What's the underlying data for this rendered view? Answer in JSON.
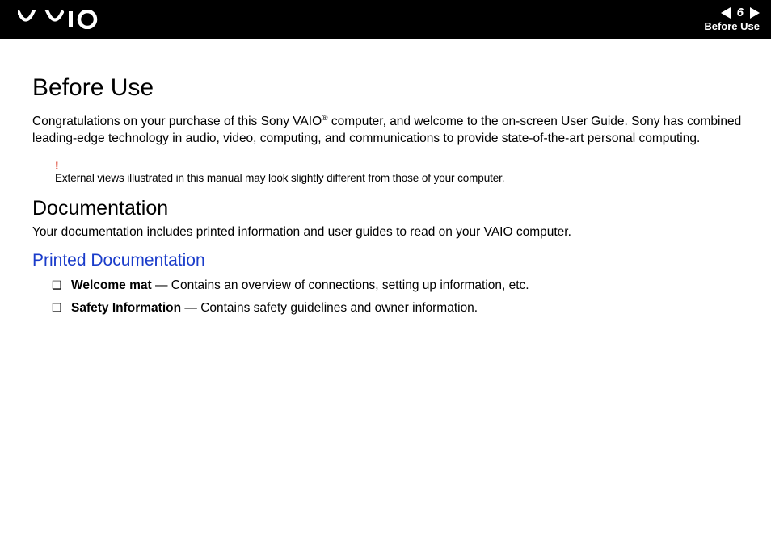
{
  "header": {
    "page_number": "6",
    "section": "Before Use"
  },
  "content": {
    "title": "Before Use",
    "intro_pre": "Congratulations on your purchase of this Sony VAIO",
    "intro_post": " computer, and welcome to the on-screen User Guide. Sony has combined leading-edge technology in audio, video, computing, and communications to provide state-of-the-art personal computing.",
    "note_bang": "!",
    "note_text": "External views illustrated in this manual may look slightly different from those of your computer.",
    "doc_heading": "Documentation",
    "doc_sub": "Your documentation includes printed information and user guides to read on your VAIO computer.",
    "printed_heading": "Printed Documentation",
    "items": [
      {
        "name": "Welcome mat",
        "desc": " — Contains an overview of connections, setting up information, etc."
      },
      {
        "name": "Safety Information",
        "desc": " — Contains safety guidelines and owner information."
      }
    ]
  }
}
